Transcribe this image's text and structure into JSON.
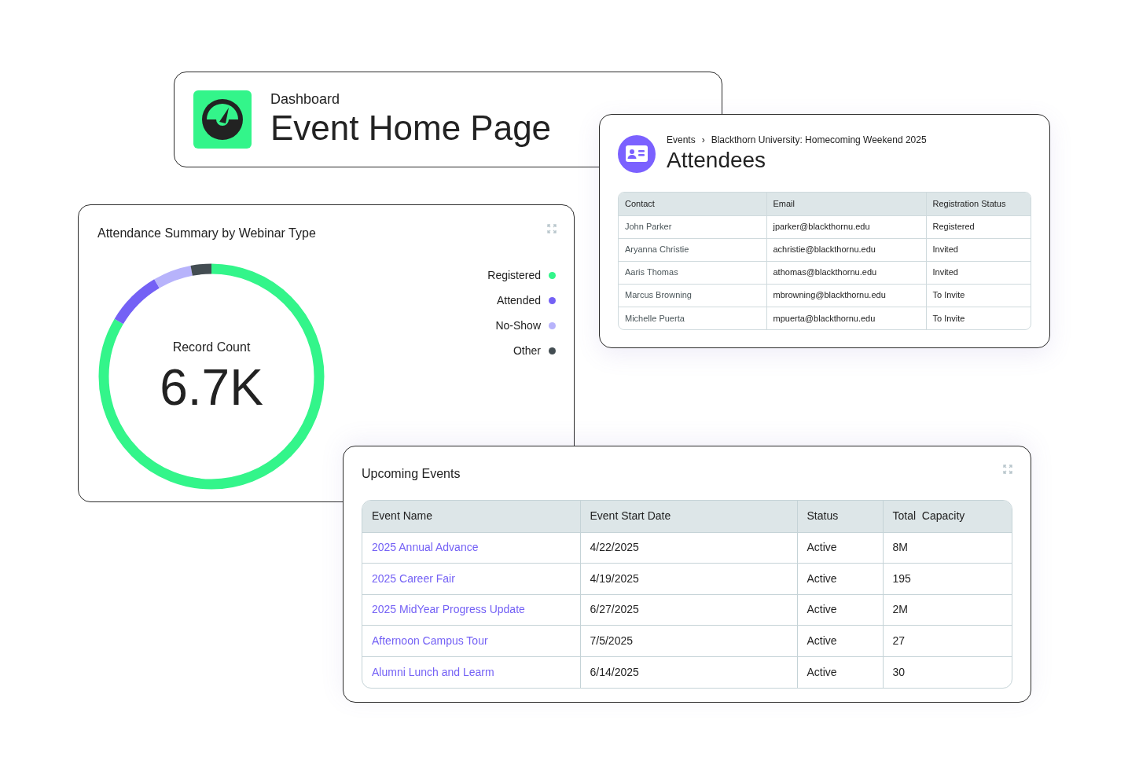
{
  "header": {
    "breadcrumb": "Dashboard",
    "title": "Event Home Page"
  },
  "attendees": {
    "breadcrumb": [
      "Events",
      "Blackthorn University: Homecoming Weekend 2025"
    ],
    "separator": "›",
    "title": "Attendees",
    "columns": [
      "Contact",
      "Email",
      "Registration Status"
    ],
    "rows": [
      [
        "John Parker",
        "jparker@blackthornu.edu",
        "Registered"
      ],
      [
        "Aryanna Christie",
        "achristie@blackthornu.edu",
        "Invited"
      ],
      [
        "Aaris Thomas",
        "athomas@blackthornu.edu",
        "Invited"
      ],
      [
        "Marcus Browning",
        "mbrowning@blackthornu.edu",
        "To Invite"
      ],
      [
        "Michelle Puerta",
        "mpuerta@blackthornu.edu",
        "To Invite"
      ]
    ]
  },
  "attendance_summary": {
    "title": "Attendance Summary by Webinar Type",
    "center_label": "Record Count",
    "center_value": "6.7K",
    "legend": [
      {
        "label": "Registered",
        "color": "#33f58a"
      },
      {
        "label": "Attended",
        "color": "#7461f5"
      },
      {
        "label": "No-Show",
        "color": "#b7b3fb"
      },
      {
        "label": "Other",
        "color": "#434d52"
      }
    ]
  },
  "upcoming_events": {
    "title": "Upcoming Events",
    "columns": [
      "Event Name",
      "Event Start Date",
      "Status",
      "Total  Capacity"
    ],
    "rows": [
      [
        "2025 Annual Advance",
        "4/22/2025",
        "Active",
        "8M"
      ],
      [
        "2025 Career Fair",
        "4/19/2025",
        "Active",
        "195"
      ],
      [
        "2025 MidYear Progress Update",
        "6/27/2025",
        "Active",
        "2M"
      ],
      [
        "Afternoon Campus Tour",
        "7/5/2025",
        "Active",
        "27"
      ],
      [
        "Alumni Lunch and Learm",
        "6/14/2025",
        "Active",
        "30"
      ]
    ]
  }
}
